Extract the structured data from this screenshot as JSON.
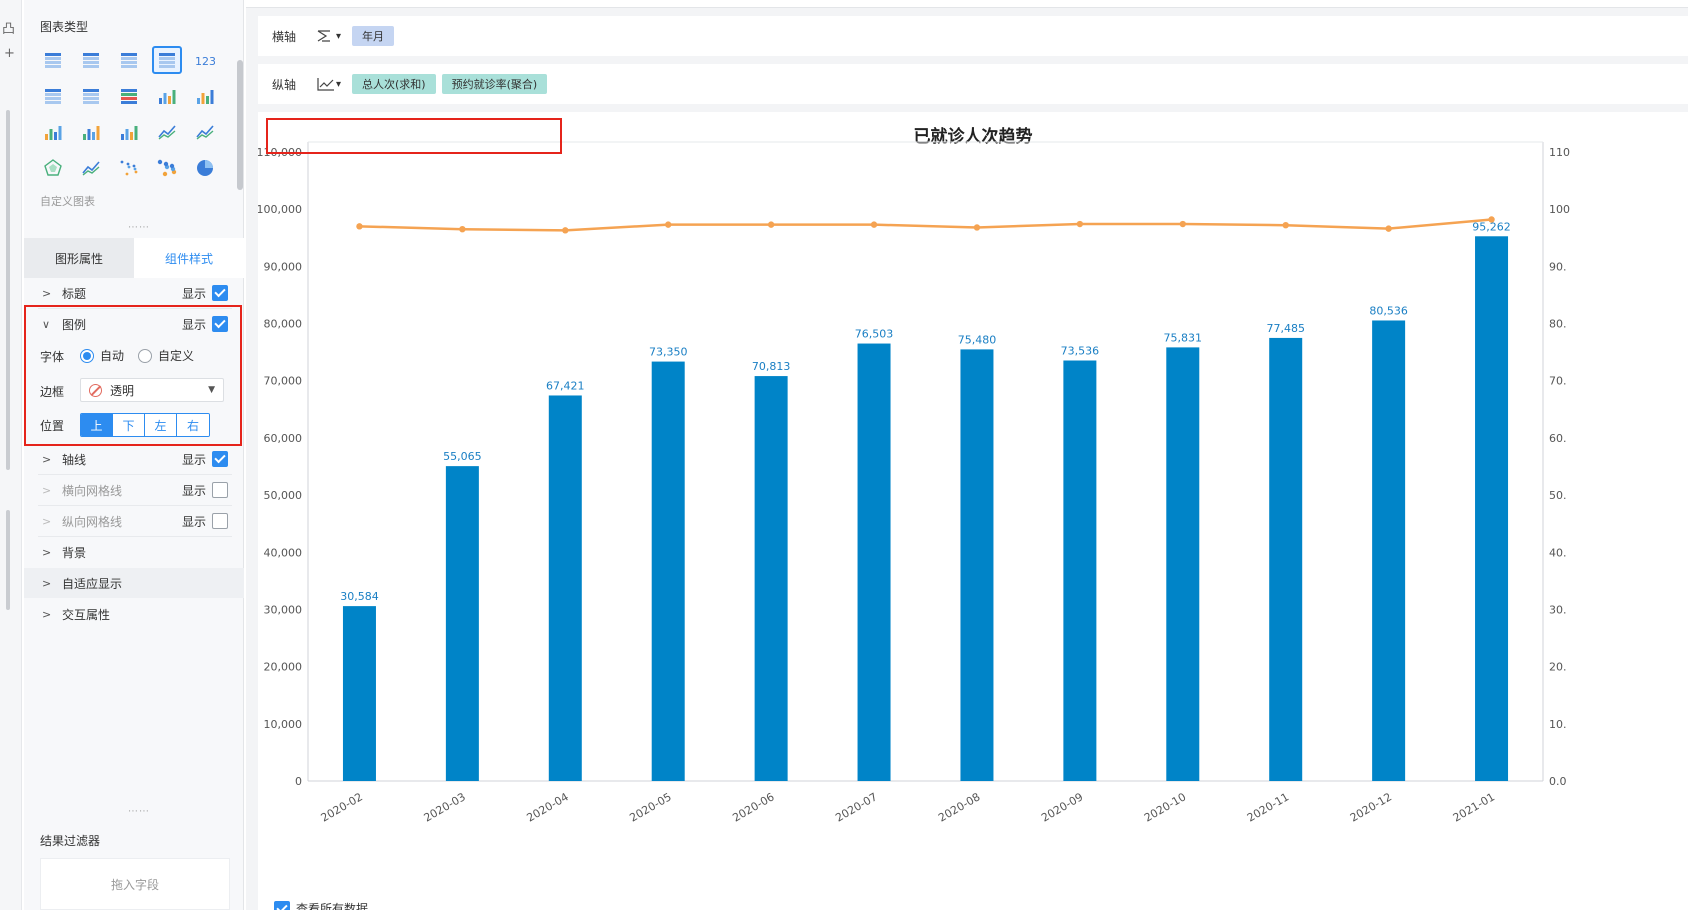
{
  "left_panel": {
    "chart_types_title": "图表类型",
    "custom_chart_label": "自定义图表",
    "chart_type_icons": [
      "table-icon",
      "cross-table-icon",
      "detail-table-icon",
      "grouped-table-icon",
      "kpi-123-icon",
      "heatmap-table-icon",
      "dot-table-icon",
      "map-heat-icon",
      "stacked-bar-icon",
      "bar-icon",
      "multi-bar-icon",
      "stacked-column-icon",
      "step-icon",
      "wave-icon",
      "line-icon",
      "radar-icon",
      "area-icon",
      "scatter-icon",
      "bubble-icon",
      "pie-icon"
    ],
    "tabs": {
      "graphic_props": "图形属性",
      "component_style": "组件样式"
    },
    "rows": {
      "title": {
        "label": "标题",
        "show": "显示"
      },
      "legend": {
        "label": "图例",
        "show": "显示"
      },
      "axis_line": {
        "label": "轴线",
        "show": "显示"
      },
      "h_grid": {
        "label": "横向网格线",
        "show": "显示"
      },
      "v_grid": {
        "label": "纵向网格线",
        "show": "显示"
      },
      "background": {
        "label": "背景"
      },
      "adaptive": {
        "label": "自适应显示"
      },
      "interaction": {
        "label": "交互属性"
      }
    },
    "legend_settings": {
      "font_label": "字体",
      "font_auto": "自动",
      "font_custom": "自定义",
      "border_label": "边框",
      "border_value": "透明",
      "position_label": "位置",
      "positions": [
        "上",
        "下",
        "左",
        "右"
      ]
    },
    "filter_title": "结果过滤器",
    "drop_field": "拖入字段"
  },
  "main": {
    "x_axis_label": "横轴",
    "x_axis_field": "年月",
    "y_axis_label": "纵轴",
    "y_axis_fields": [
      "总人次(求和)",
      "预约就诊率(聚合)"
    ],
    "view_all_data": "查看所有数据"
  },
  "colors": {
    "bar": "#0084c8",
    "line": "#f5a352",
    "accent": "#2d8cf0",
    "annotation": "#e5241b"
  },
  "chart_data": {
    "type": "bar",
    "title": "已就诊人次趋势",
    "categories": [
      "2020-02",
      "2020-03",
      "2020-04",
      "2020-05",
      "2020-06",
      "2020-07",
      "2020-08",
      "2020-09",
      "2020-10",
      "2020-11",
      "2020-12",
      "2021-01"
    ],
    "series": [
      {
        "values": [
          30584,
          55065,
          67421,
          73350,
          70813,
          76503,
          75480,
          73536,
          75831,
          77485,
          80536,
          95262
        ]
      },
      {
        "type": "line",
        "axis": "right",
        "values": [
          97000,
          96500,
          96300,
          97300,
          97300,
          97300,
          96800,
          97400,
          97400,
          97200,
          96600,
          98200
        ]
      }
    ],
    "y_ticks": [
      "0",
      "10,000",
      "20,000",
      "30,000",
      "40,000",
      "50,000",
      "60,000",
      "70,000",
      "80,000",
      "90,000",
      "100,000",
      "110,000"
    ],
    "right_ticks": [
      "0.0",
      "10.",
      "20.",
      "30.",
      "40.",
      "50.",
      "60.",
      "70.",
      "80.",
      "90.",
      "100",
      "110"
    ],
    "ylim": [
      0,
      110000
    ],
    "grid": false,
    "legend": "none"
  }
}
